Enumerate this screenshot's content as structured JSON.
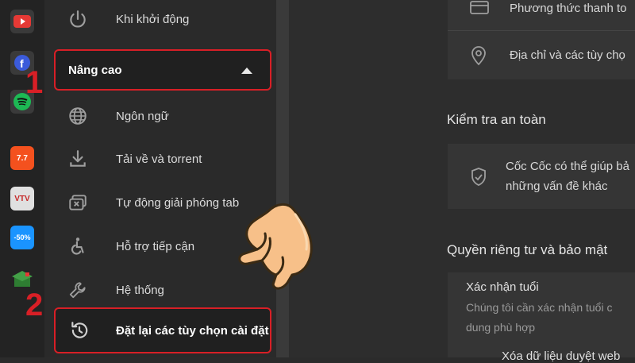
{
  "sidebar": {
    "items": [
      {
        "label": "Khi khởi động",
        "icon": "power-icon"
      },
      {
        "label": "Nâng cao",
        "icon": "caret-up-icon"
      },
      {
        "label": "Ngôn ngữ",
        "icon": "globe-icon"
      },
      {
        "label": "Tải về và torrent",
        "icon": "download-icon"
      },
      {
        "label": "Tự động giải phóng tab",
        "icon": "tab-discard-icon"
      },
      {
        "label": "Hỗ trợ tiếp cận",
        "icon": "accessibility-icon"
      },
      {
        "label": "Hệ thống",
        "icon": "wrench-icon"
      },
      {
        "label": "Đặt lại các tùy chọn cài đặt",
        "icon": "restore-icon"
      }
    ]
  },
  "annotations": {
    "step1": "1",
    "step2": "2"
  },
  "dock": {
    "apps": [
      {
        "name": "youtube-icon",
        "color": "#e53935"
      },
      {
        "name": "facebook-icon",
        "color": "#3b5bdb"
      },
      {
        "name": "spotify-icon",
        "color": "#1db954"
      },
      {
        "name": "shopee-icon",
        "color": "#f4511e",
        "text": "7.7"
      },
      {
        "name": "vtv-icon",
        "color": "#e0e0e0",
        "text": "VTV"
      },
      {
        "name": "tiki-icon",
        "color": "#1a94ff",
        "text": "-50%"
      },
      {
        "name": "education-icon",
        "color": "#2e7d32"
      }
    ]
  },
  "main": {
    "payment_label": "Phương thức thanh to",
    "address_label": "Địa chỉ và các tùy chọ",
    "safety_title": "Kiểm tra an toàn",
    "safety_line1": "Cốc Cốc có thể giúp bả",
    "safety_line2": "những vấn đề khác",
    "privacy_title": "Quyền riêng tư và bảo mật",
    "age_title": "Xác nhận tuổi",
    "age_line1": "Chúng tôi cần xác nhận tuổi c",
    "age_line2": "dung phù hợp",
    "age_line3": "Xóa dữ liệu duyệt web"
  },
  "colors": {
    "accent_red": "#d81f26",
    "bg": "#2b2b2b"
  }
}
